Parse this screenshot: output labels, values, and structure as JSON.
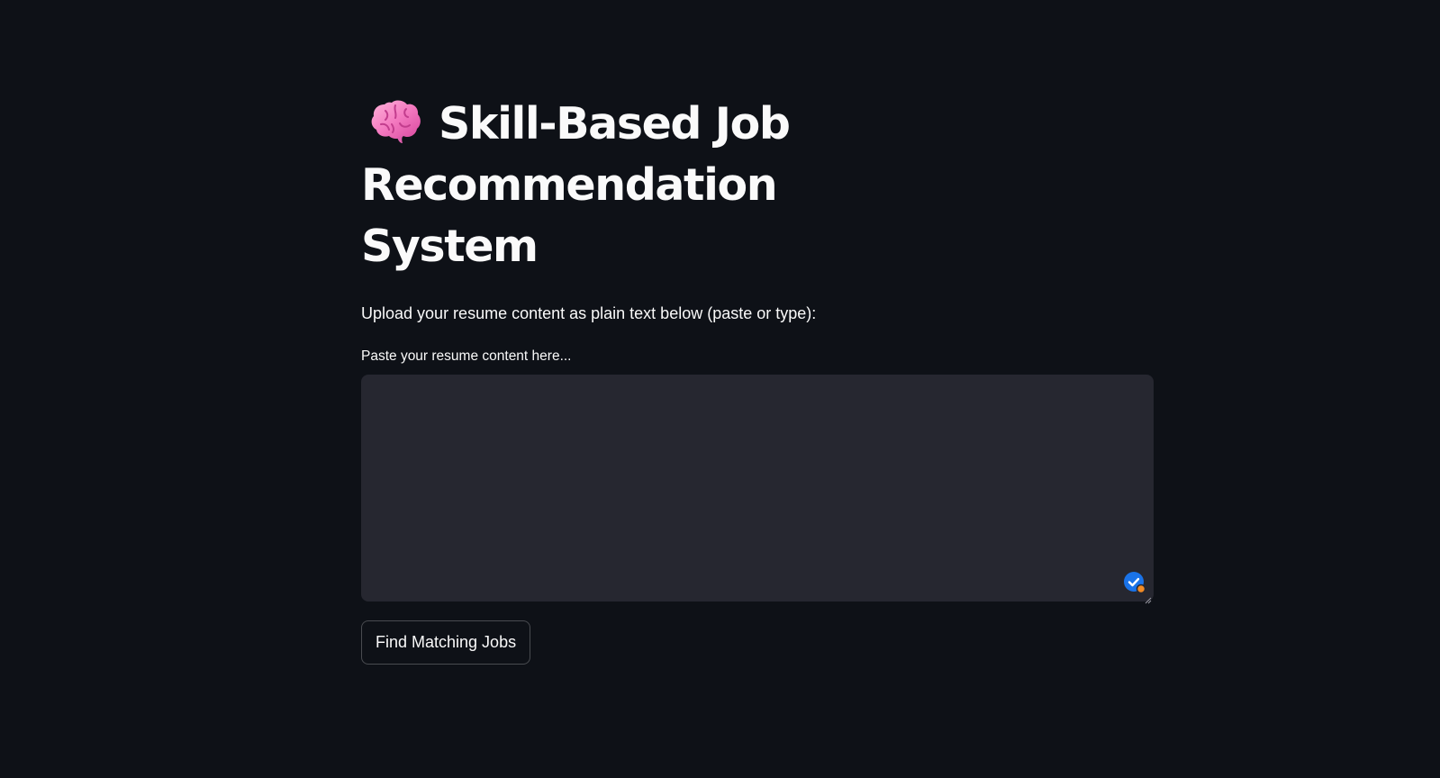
{
  "header": {
    "icon": "brain-icon",
    "title": "Skill-Based Job Recommendation System"
  },
  "main": {
    "instructions": "Upload your resume content as plain text below (paste or type):",
    "resume_field": {
      "label": "Paste your resume content here...",
      "value": "",
      "placeholder": ""
    },
    "submit_label": "Find Matching Jobs"
  },
  "colors": {
    "background": "#0e1117",
    "input_background": "#262730",
    "text": "#fafafa",
    "grammar_badge": "#1a73e8",
    "grammar_dot": "#f28b25"
  }
}
